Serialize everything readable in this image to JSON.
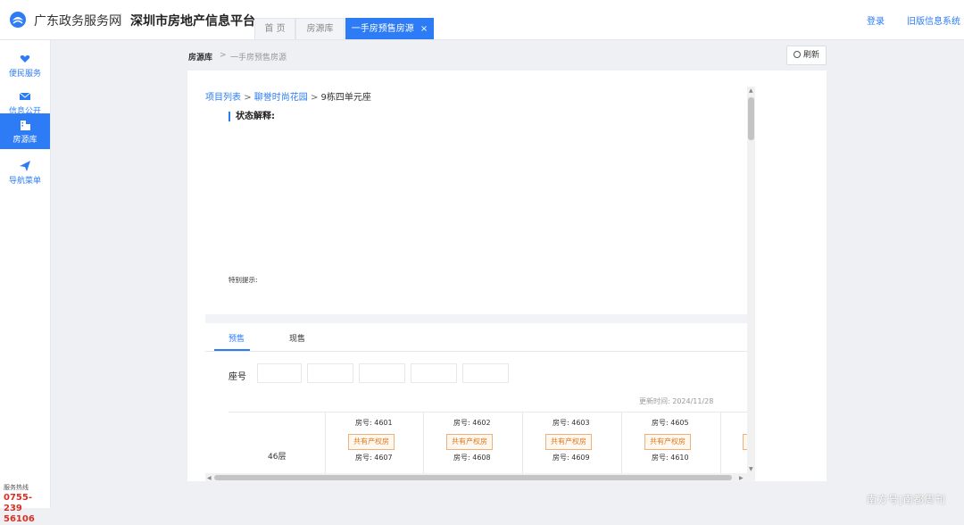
{
  "header": {
    "site_name": "广东政务服务网",
    "platform": "深圳市房地产信息平台",
    "tabs": [
      {
        "label": "首 页"
      },
      {
        "label": "房源库"
      },
      {
        "label": "一手房预售房源",
        "close": "×"
      }
    ],
    "login": "登录",
    "old_system": "旧版信息系统"
  },
  "sidebar": {
    "items": [
      {
        "label": "便民服务"
      },
      {
        "label": "信息公开"
      },
      {
        "label": "房源库"
      },
      {
        "label": "导航菜单"
      }
    ],
    "footer_lines": [
      "",
      "",
      "",
      "",
      "",
      "",
      "",
      "",
      "",
      "",
      "",
      "",
      "",
      ""
    ],
    "hotline_label": "服务热线",
    "hotline_a": "0755-239",
    "hotline_b": "56106"
  },
  "breadcrumb": {
    "root": "房源库",
    "sep": ">",
    "current": "一手房预售房源"
  },
  "refresh_label": "刷新",
  "path": {
    "project_list": "项目列表",
    "sep1": ">",
    "project": "聊誉时尚花园",
    "sep2": ">",
    "building": "9栋四单元座"
  },
  "status": {
    "title": "状态解释:",
    "notes": [
      "",
      "",
      "",
      "",
      "",
      "",
      "",
      "",
      "",
      "",
      "",
      "",
      "",
      "",
      "",
      ""
    ],
    "tip_title": "特别提示:",
    "tip_text": ""
  },
  "sale_tabs": [
    {
      "label": "预售"
    },
    {
      "label": "现售"
    }
  ],
  "seat": {
    "label": "座号",
    "units": [
      {
        "label": "",
        "selected": true
      },
      {
        "label": "",
        "selected": false
      },
      {
        "label": "",
        "selected": false
      },
      {
        "label": "",
        "selected": false
      },
      {
        "label": "",
        "selected": false
      }
    ]
  },
  "updated": {
    "label": "更新时间:",
    "date": "2024/11/28"
  },
  "floor": {
    "label": "46层",
    "row1": [
      {
        "room": "房号: 4601",
        "status": "共有产权房"
      },
      {
        "room": "房号: 4602",
        "status": "共有产权房"
      },
      {
        "room": "房号: 4603",
        "status": "共有产权房"
      },
      {
        "room": "房号: 4605",
        "status": "共有产权房"
      }
    ],
    "row2": [
      {
        "room": "房号: 4607"
      },
      {
        "room": "房号: 4608"
      },
      {
        "room": "房号: 4609"
      },
      {
        "room": "房号: 4610"
      }
    ]
  },
  "watermark": "南方号|南都周刊",
  "colors": {
    "accent": "#2d7cf6",
    "tag_orange": "#e07a1f",
    "selected_red": "#d93025"
  }
}
